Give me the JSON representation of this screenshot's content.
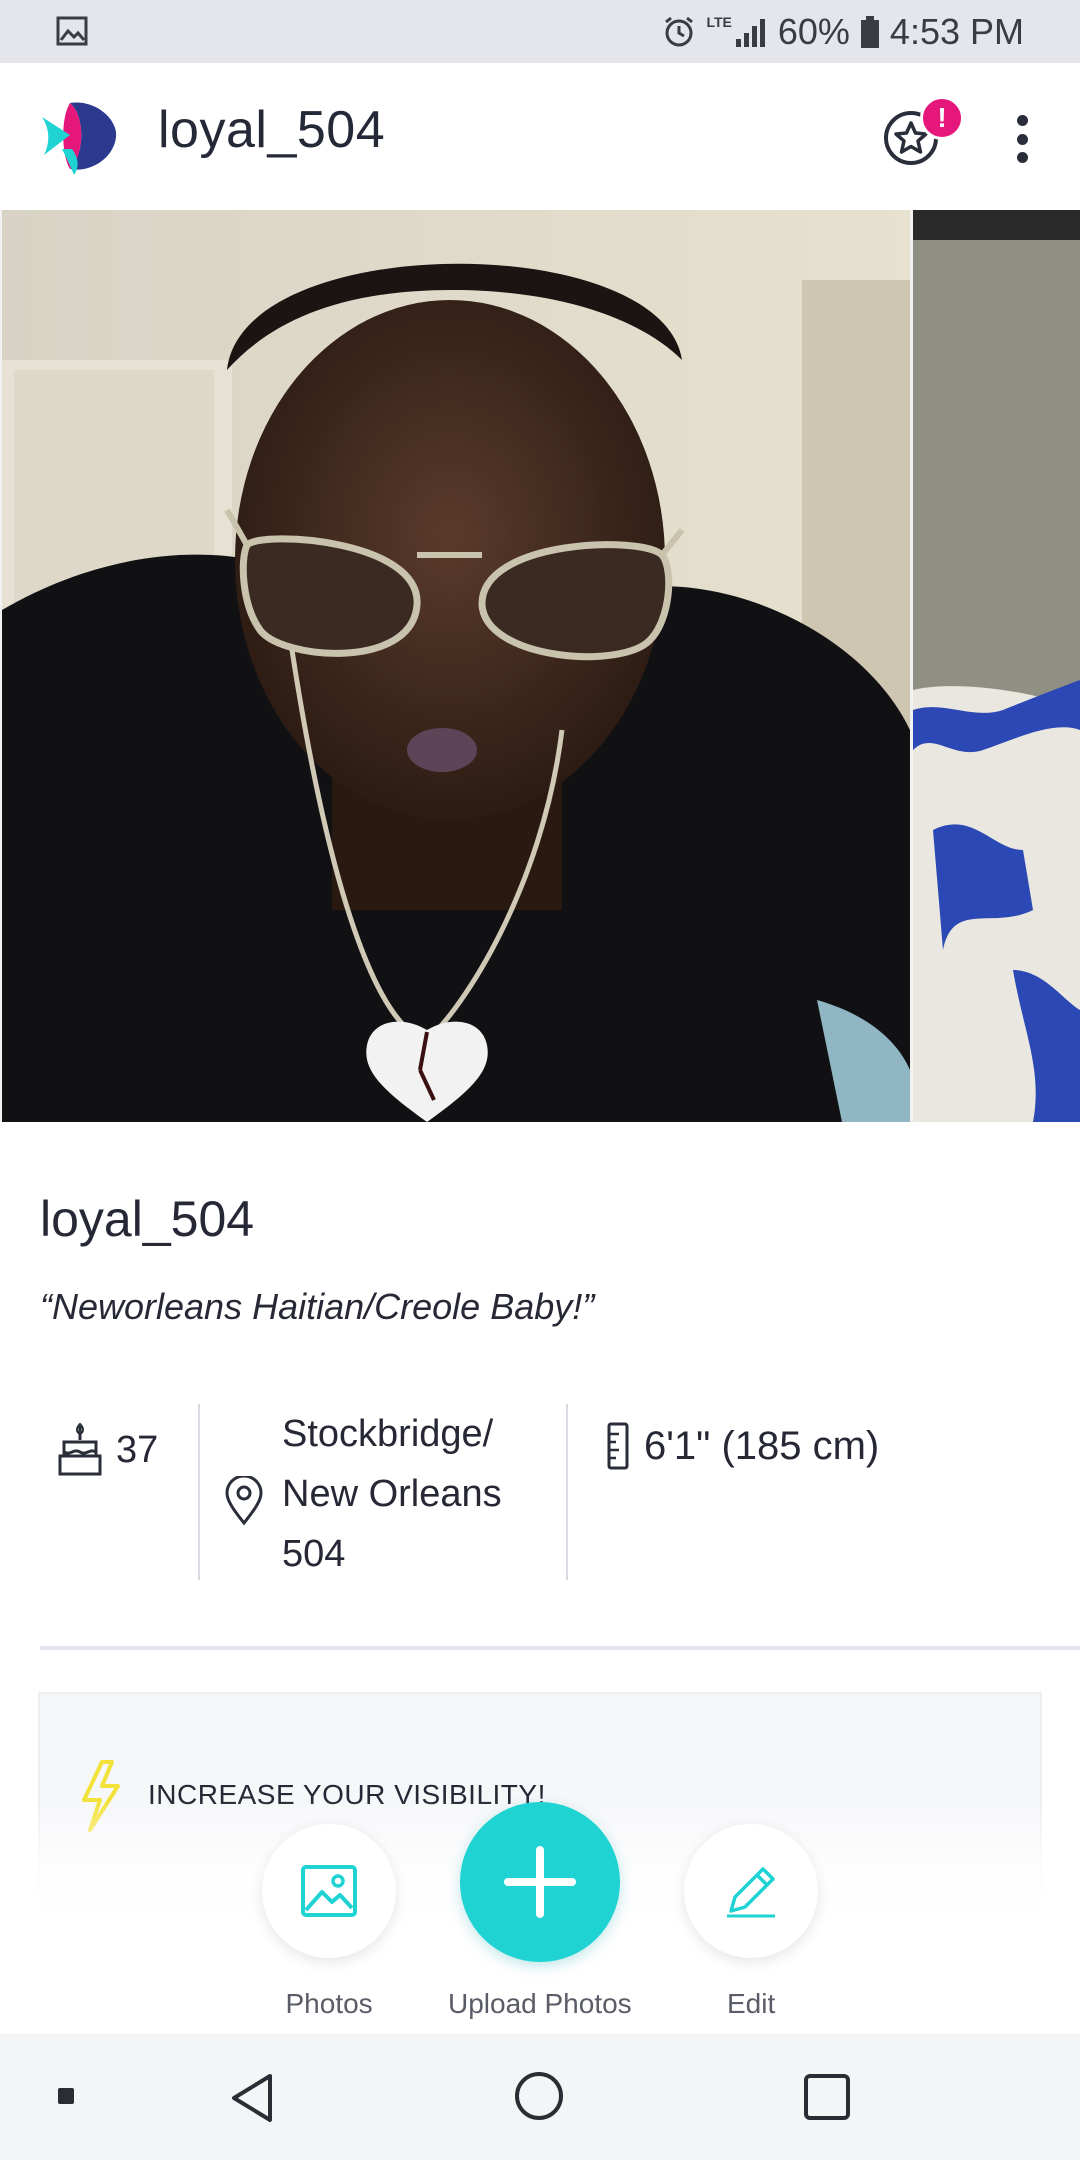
{
  "status_bar": {
    "battery": "60%",
    "time": "4:53 PM",
    "network": "LTE",
    "icons": [
      "gallery-icon",
      "alarm-icon",
      "signal-icon",
      "battery-icon"
    ]
  },
  "header": {
    "title": "loyal_504",
    "notification_badge": "!",
    "icons": [
      "app-logo",
      "star-icon",
      "more-vert-icon"
    ]
  },
  "profile": {
    "username": "loyal_504",
    "tagline": "“Neworleans Haitian/Creole Baby!”",
    "age": "37",
    "location": [
      "Stockbridge/",
      "New Orleans",
      "504"
    ],
    "height": "6'1\" (185 cm)"
  },
  "visibility_card": {
    "label": "INCREASE YOUR VISIBILITY!"
  },
  "actions": {
    "photos": "Photos",
    "upload": "Upload Photos",
    "edit": "Edit"
  },
  "colors": {
    "accent": "#1fd3d3",
    "badge": "#e6177a",
    "bolt": "#f2e23a"
  }
}
